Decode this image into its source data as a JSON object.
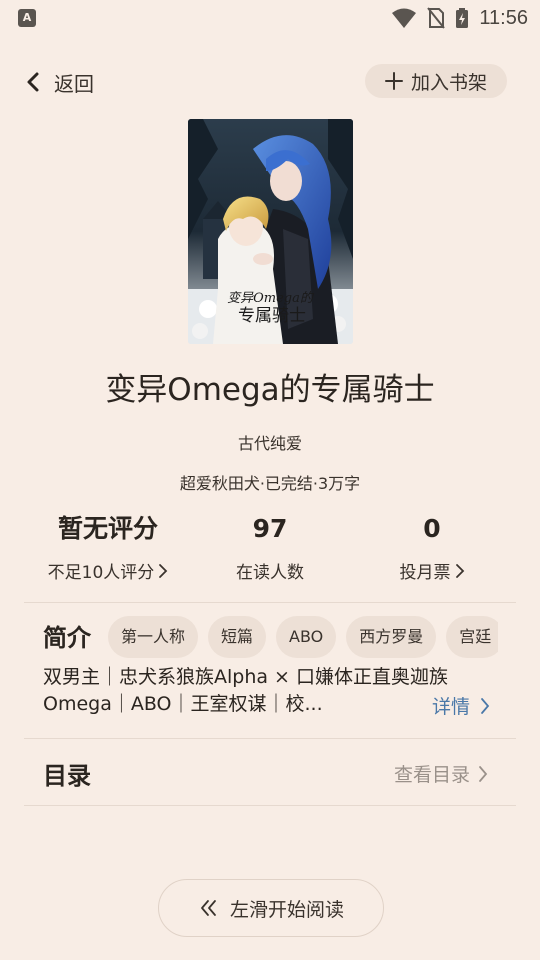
{
  "status_bar": {
    "time": "11:56"
  },
  "header": {
    "back_label": "返回",
    "add_shelf_label": "加入书架"
  },
  "book": {
    "title": "变异Omega的专属骑士",
    "category": "古代纯爱",
    "meta": "超爱秋田犬·已完结·3万字"
  },
  "stats": [
    {
      "value": "暂无评分",
      "label": "不足10人评分"
    },
    {
      "value": "97",
      "label": "在读人数"
    },
    {
      "value": "0",
      "label": "投月票"
    }
  ],
  "intro": {
    "heading": "简介",
    "tags": [
      "第一人称",
      "短篇",
      "ABO",
      "西方罗曼",
      "宫廷"
    ],
    "line1": "双男主｜忠犬系狼族Alpha × 口嫌体正直奥迦族",
    "line2": "Omega｜ABO｜王室权谋｜校...",
    "details_label": "详情"
  },
  "toc": {
    "heading": "目录",
    "link_label": "查看目录"
  },
  "footer": {
    "start_label": "左滑开始阅读"
  }
}
